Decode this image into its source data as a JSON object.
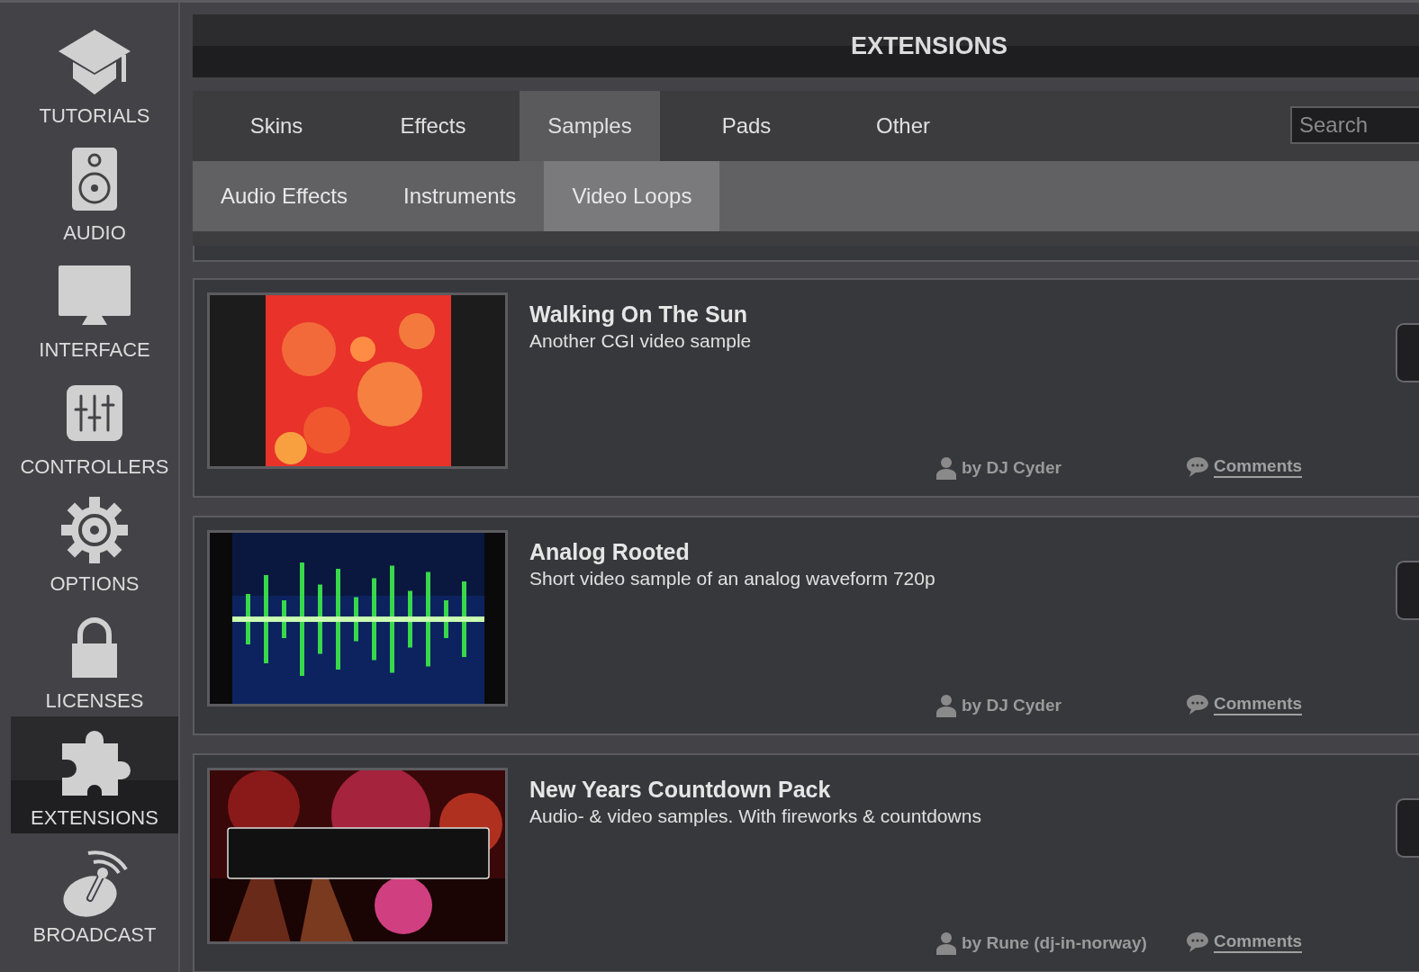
{
  "sidebar": {
    "items": [
      {
        "label": "TUTORIALS",
        "selected": false
      },
      {
        "label": "AUDIO",
        "selected": false
      },
      {
        "label": "INTERFACE",
        "selected": false
      },
      {
        "label": "CONTROLLERS",
        "selected": false
      },
      {
        "label": "OPTIONS",
        "selected": false
      },
      {
        "label": "LICENSES",
        "selected": false
      },
      {
        "label": "EXTENSIONS",
        "selected": true
      },
      {
        "label": "BROADCAST",
        "selected": false
      }
    ]
  },
  "header": {
    "title": "EXTENSIONS"
  },
  "tabs": [
    {
      "label": "Skins",
      "selected": false
    },
    {
      "label": "Effects",
      "selected": false
    },
    {
      "label": "Samples",
      "selected": true
    },
    {
      "label": "Pads",
      "selected": false
    },
    {
      "label": "Other",
      "selected": false
    }
  ],
  "search": {
    "placeholder": "Search"
  },
  "subtabs": [
    {
      "label": "Audio Effects",
      "selected": false
    },
    {
      "label": "Instruments",
      "selected": false
    },
    {
      "label": "Video Loops",
      "selected": true
    }
  ],
  "extensions": [
    {
      "title": "Walking On The Sun",
      "description": "Another CGI video sample",
      "author": "by DJ Cyder",
      "comments": "Comments"
    },
    {
      "title": "Analog Rooted",
      "description": "Short video sample of an analog waveform 720p",
      "author": "by DJ Cyder",
      "comments": "Comments"
    },
    {
      "title": "New Years Countdown Pack",
      "description": "Audio- & video samples. With fireworks & countdowns",
      "author": "by Rune (dj-in-norway)",
      "comments": "Comments"
    }
  ]
}
